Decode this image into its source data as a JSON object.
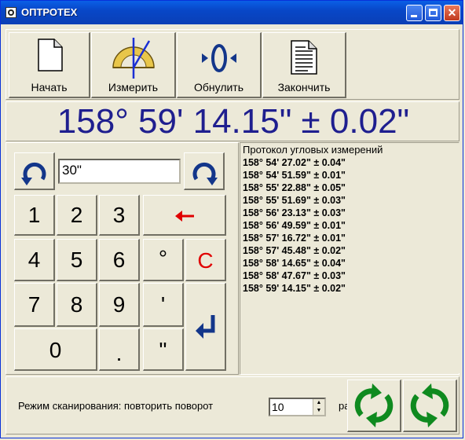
{
  "window": {
    "title": "ОПТРОТЕХ"
  },
  "toolbar": {
    "start_label": "Начать",
    "measure_label": "Измерить",
    "zero_label": "Обнулить",
    "finish_label": "Закончить"
  },
  "readout": {
    "value": "158° 59' 14.15\" ± 0.02\""
  },
  "keypad": {
    "step_value": "30\"",
    "keys": {
      "k1": "1",
      "k2": "2",
      "k3": "3",
      "k4": "4",
      "k5": "5",
      "k6": "6",
      "k7": "7",
      "k8": "8",
      "k9": "9",
      "k0": "0",
      "dot": ".",
      "degree": "°",
      "minute": "'",
      "second": "\"",
      "clear": "C"
    }
  },
  "log": {
    "title": "Протокол угловых измерений",
    "rows": [
      "158° 54' 27.02\" ± 0.04\"",
      "158° 54' 51.59\" ± 0.01\"",
      "158° 55' 22.88\" ± 0.05\"",
      "158° 55' 51.69\" ± 0.03\"",
      "158° 56' 23.13\" ± 0.03\"",
      "158° 56' 49.59\" ± 0.01\"",
      "158° 57' 16.72\" ± 0.01\"",
      "158° 57' 45.48\" ± 0.02\"",
      "158° 58' 14.65\" ± 0.04\"",
      "158° 58' 47.67\" ± 0.03\"",
      "158° 59' 14.15\" ± 0.02\""
    ]
  },
  "scan": {
    "label": "Режим сканирования: повторить поворот",
    "repeat_value": "10",
    "suffix": "ра"
  },
  "colors": {
    "readout": "#1f1f8f",
    "accent_red": "#e00000",
    "rotate_green": "#0f8a1f",
    "rotate_blue": "#13368a"
  }
}
